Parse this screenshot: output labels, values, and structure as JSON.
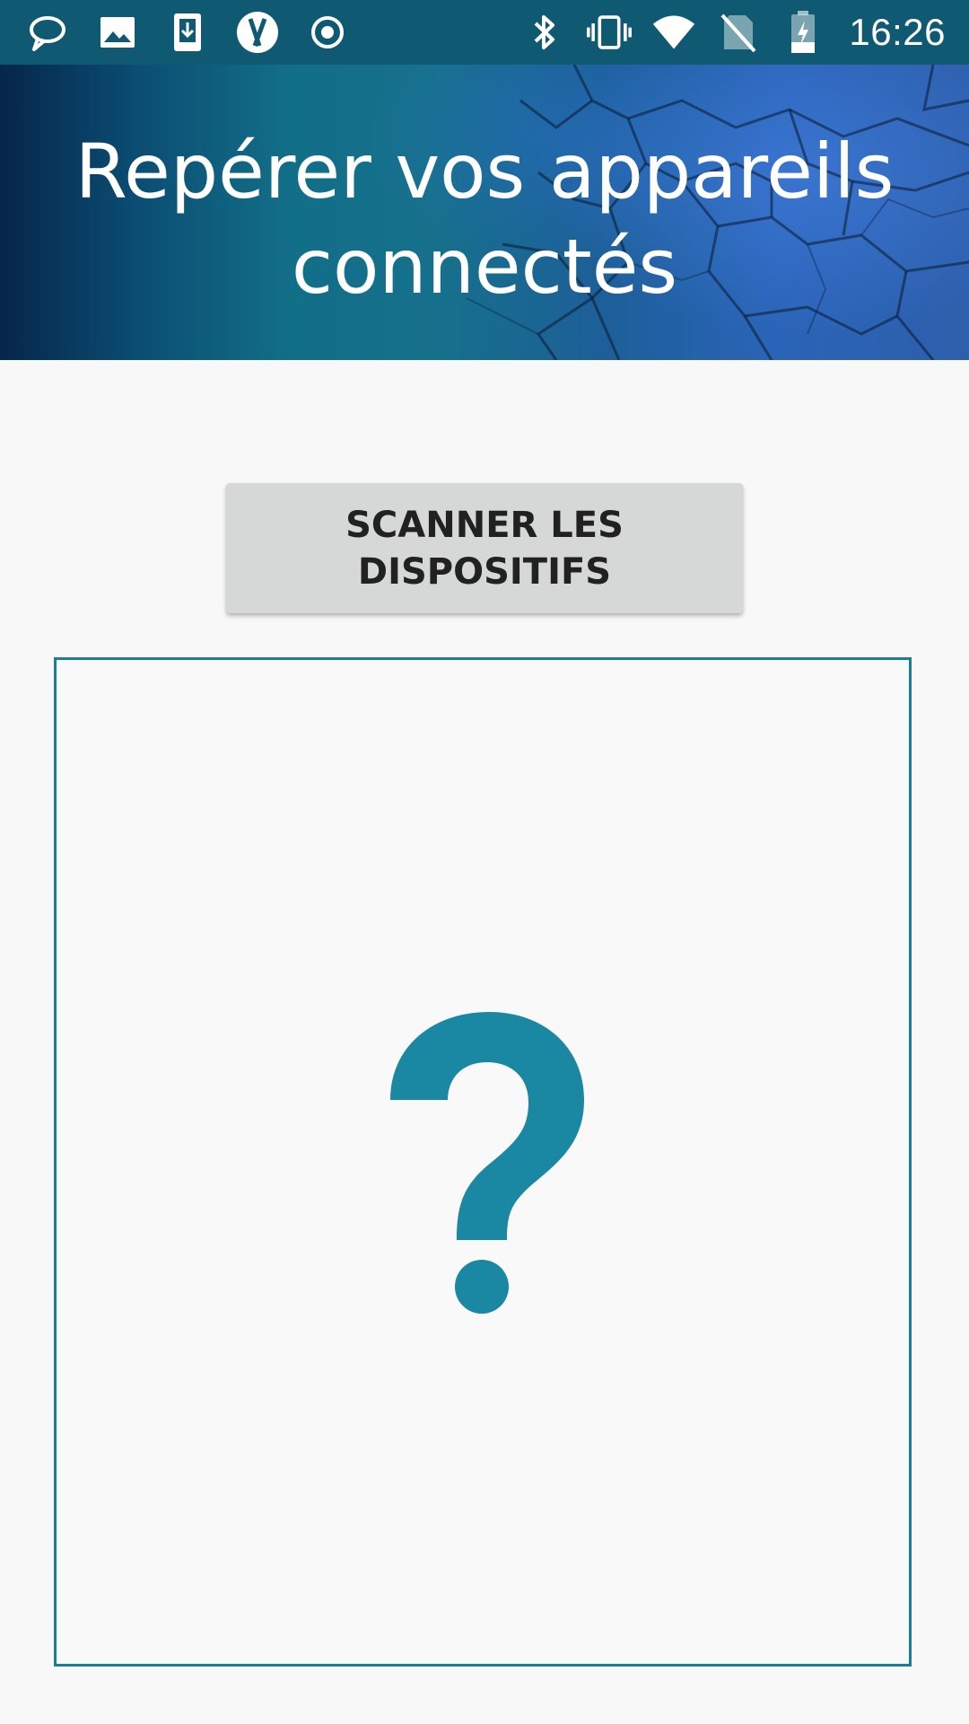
{
  "status_bar": {
    "time": "16:26",
    "left_icons": [
      "chat-bubble-icon",
      "image-icon",
      "download-icon",
      "android-icon",
      "record-icon"
    ],
    "right_icons": [
      "bluetooth-icon",
      "vibrate-icon",
      "wifi-icon",
      "no-sim-icon",
      "battery-charging-icon"
    ]
  },
  "header": {
    "title": "Repérer vos appareils connectés"
  },
  "main": {
    "scan_button_label": "SCANNER LES DISPOSITIFS",
    "result_icon": "question-mark-icon"
  },
  "colors": {
    "status_bar": "#0f5a72",
    "accent": "#1a87a3",
    "frame_border": "#1c7d96",
    "button_bg": "#d6d7d7",
    "background": "#f8f8f8"
  }
}
